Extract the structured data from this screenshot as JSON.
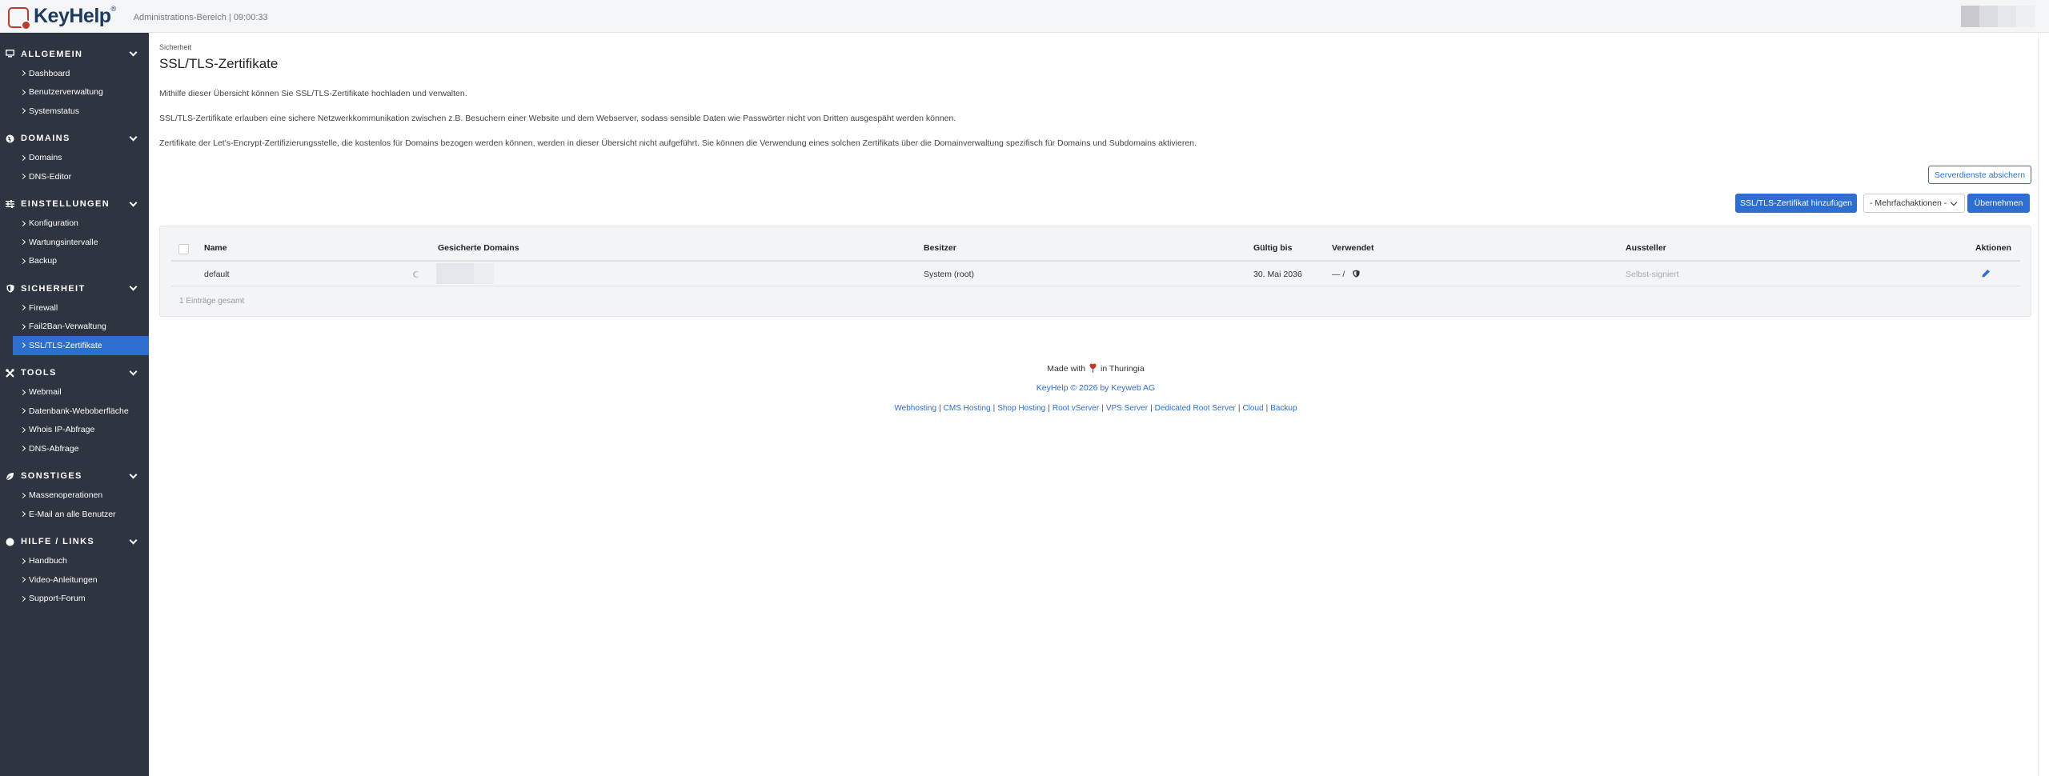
{
  "topbar": {
    "logo_text": "KeyHelp",
    "logo_reg": "®",
    "subtitle": "Administrations-Bereich | 09:00:33"
  },
  "sidebar": {
    "sections": [
      {
        "label": "ALLGEMEIN",
        "icon": "monitor-icon",
        "items": [
          "Dashboard",
          "Benutzerverwaltung",
          "Systemstatus"
        ]
      },
      {
        "label": "DOMAINS",
        "icon": "globe-icon",
        "items": [
          "Domains",
          "DNS-Editor"
        ]
      },
      {
        "label": "EINSTELLUNGEN",
        "icon": "sliders-icon",
        "items": [
          "Konfiguration",
          "Wartungsintervalle",
          "Backup"
        ]
      },
      {
        "label": "SICHERHEIT",
        "icon": "shield-icon",
        "items": [
          "Firewall",
          "Fail2Ban-Verwaltung",
          "SSL/TLS-Zertifikate"
        ]
      },
      {
        "label": "TOOLS",
        "icon": "tools-icon",
        "items": [
          "Webmail",
          "Datenbank-Weboberfläche",
          "Whois IP-Abfrage",
          "DNS-Abfrage"
        ]
      },
      {
        "label": "SONSTIGES",
        "icon": "leaf-icon",
        "items": [
          "Massenoperationen",
          "E-Mail an alle Benutzer"
        ]
      },
      {
        "label": "HILFE / LINKS",
        "icon": "info-icon",
        "items": [
          "Handbuch",
          "Video-Anleitungen",
          "Support-Forum"
        ]
      }
    ],
    "active_item": "SSL/TLS-Zertifikate"
  },
  "main": {
    "breadcrumb": "Sicherheit",
    "title": "SSL/TLS-Zertifikate",
    "paragraphs": [
      "Mithilfe dieser Übersicht können Sie SSL/TLS-Zertifikate hochladen und verwalten.",
      "SSL/TLS-Zertifikate erlauben eine sichere Netzwerkkommunikation zwischen z.B. Besuchern einer Website und dem Webserver, sodass sensible Daten wie Passwörter nicht von Dritten ausgespäht werden können.",
      "Zertifikate der Let's-Encrypt-Zertifizierungsstelle, die kostenlos für Domains bezogen werden können, werden in dieser Übersicht nicht aufgeführt. Sie können die Verwendung eines solchen Zertifikats über die Domainverwaltung spezifisch für Domains und Subdomains aktivieren."
    ],
    "secure_services_button": "Serverdienste absichern",
    "add_button": "SSL/TLS-Zertifikat hinzufügen",
    "bulk_select": "- Mehrfachaktionen -",
    "apply_button": "Übernehmen",
    "table": {
      "headers": [
        "Name",
        "Gesicherte Domains",
        "Besitzer",
        "Gültig bis",
        "Verwendet",
        "Aussteller",
        "Aktionen"
      ],
      "rows": [
        {
          "name": "default",
          "domains": "",
          "owner": "System (root)",
          "valid_until": "30. Mai 2036",
          "used": "— /",
          "issuer": "Selbst-signiert"
        }
      ],
      "total": "1 Einträge gesamt"
    }
  },
  "footer": {
    "made_with_prefix": "Made with",
    "made_with_suffix": "in Thuringia",
    "copyright": "KeyHelp © 2026 by Keyweb AG",
    "links": [
      "Webhosting",
      "CMS Hosting",
      "Shop Hosting",
      "Root vServer",
      "VPS Server",
      "Dedicated Root Server",
      "Cloud",
      "Backup"
    ],
    "link_separator": "|"
  },
  "colors": {
    "accent": "#2d6fd1",
    "sidebar_bg": "#2e3440",
    "logo_red": "#c0392b"
  }
}
